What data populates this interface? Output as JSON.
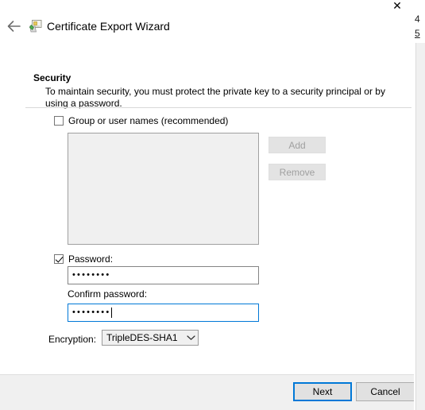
{
  "window": {
    "title": "Certificate Export Wizard",
    "back_icon": "back-arrow-icon",
    "app_icon": "certificate-wizard-icon",
    "close_label": "✕"
  },
  "background_window": {
    "line1": "4",
    "line2": "5"
  },
  "page": {
    "heading": "Security",
    "description": "To maintain security, you must protect the private key to a security principal or by using a password."
  },
  "group_names": {
    "checkbox_label": "Group or user names (recommended)",
    "checked": false,
    "list_items": [],
    "add_label": "Add",
    "remove_label": "Remove",
    "add_enabled": false,
    "remove_enabled": false
  },
  "password_section": {
    "checkbox_label": "Password:",
    "checked": true,
    "password_value": "••••••••",
    "confirm_label": "Confirm password:",
    "confirm_value": "••••••••",
    "confirm_focused": true
  },
  "encryption": {
    "label": "Encryption:",
    "selected": "TripleDES-SHA1",
    "chevron_icon": "chevron-down-icon"
  },
  "footer": {
    "next_label": "Next",
    "cancel_label": "Cancel",
    "next_is_default": true
  },
  "colors": {
    "accent": "#0078d7",
    "footer_bg": "#f0f0f0",
    "listbox_bg": "#f0f0f0",
    "disabled_text": "#a0a0a0"
  }
}
